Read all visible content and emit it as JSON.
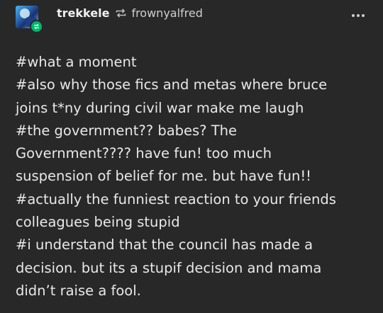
{
  "post": {
    "username": "trekkele",
    "reblogged_from": "frownyalfred",
    "avatar_icon": "avatar-image",
    "reblog_icon": "reblog-icon",
    "menu_icon": "more-options-icon",
    "accent": "#00b86b",
    "lines": [
      "#what a moment",
      "#also why those fics and metas where bruce",
      "joins t*ny during civil war make me laugh",
      "#the government?? babes? The",
      "Government???? have fun! too much",
      "suspension of belief for me. but have fun!!",
      "#actually the funniest reaction to your friends",
      "colleagues being stupid",
      "#i understand that the council has made a",
      "decision. but its a stupif decision and mama",
      "didn’t raise a fool."
    ]
  }
}
